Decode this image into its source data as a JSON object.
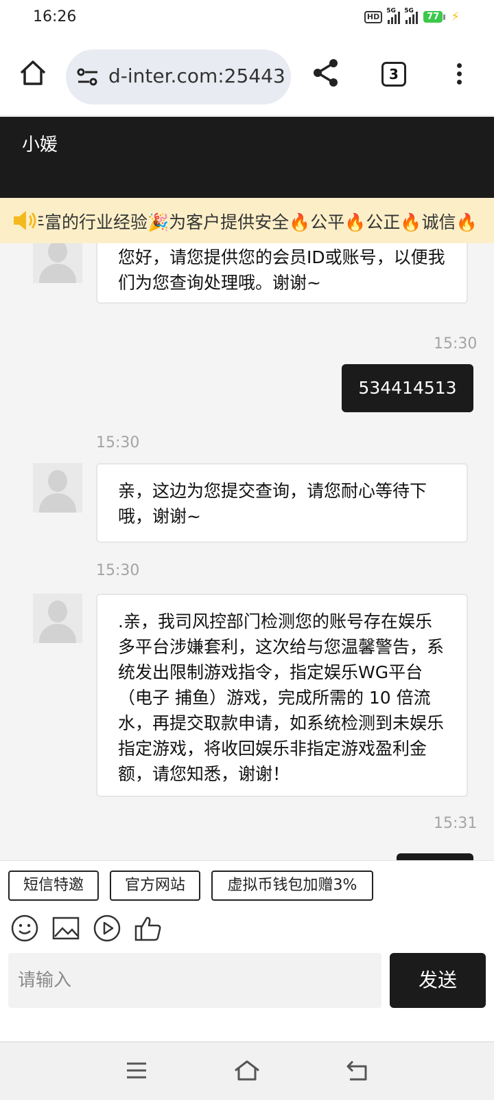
{
  "status_bar": {
    "time": "16:26",
    "hd_label": "HD",
    "signal1_label": "5G",
    "signal2_label": "5G",
    "battery": "77"
  },
  "browser": {
    "url": "d-inter.com:25443",
    "tab_count": "3"
  },
  "chat": {
    "title": "小媛",
    "marquee": "丰富的行业经验🎉为客户提供安全🔥公平🔥公正🔥诚信🔥",
    "messages": [
      {
        "time": "",
        "text": "您好，请您提供您的会员ID或账号，以便我们为您查询处理哦。谢谢~"
      },
      {
        "time": "15:30",
        "text": "534414513"
      },
      {
        "time": "15:30",
        "text": "亲，这边为您提交查询，请您耐心等待下哦，谢谢~"
      },
      {
        "time": "15:30",
        "text": ".亲，我司风控部门检测您的账号存在娱乐多平台涉嫌套利，这次给与您温馨警告，系统发出限制游戏指令，指定娱乐WG平台（电子 捕鱼）游戏，完成所需的 10 倍流水，再提交取款申请，如系统检测到未娱乐指定游戏，将收回娱乐非指定游戏盈利金额，请您知悉，谢谢！"
      },
      {
        "time": "15:31",
        "text": ""
      }
    ]
  },
  "quick_replies": [
    "短信特邀",
    "官方网站",
    "虚拟币钱包加赠3%"
  ],
  "input": {
    "placeholder": "请输入",
    "send_label": "发送"
  },
  "icons": {
    "toolbar": [
      "emoji-icon",
      "image-icon",
      "video-icon",
      "thumbs-up-icon"
    ],
    "nav": [
      "menu-icon",
      "home-icon",
      "back-icon"
    ]
  },
  "colors": {
    "header_bg": "#1b1b1b",
    "marquee_bg": "#fcefc8",
    "battery": "#3cc84a",
    "page_bg": "#f4f4f4"
  }
}
